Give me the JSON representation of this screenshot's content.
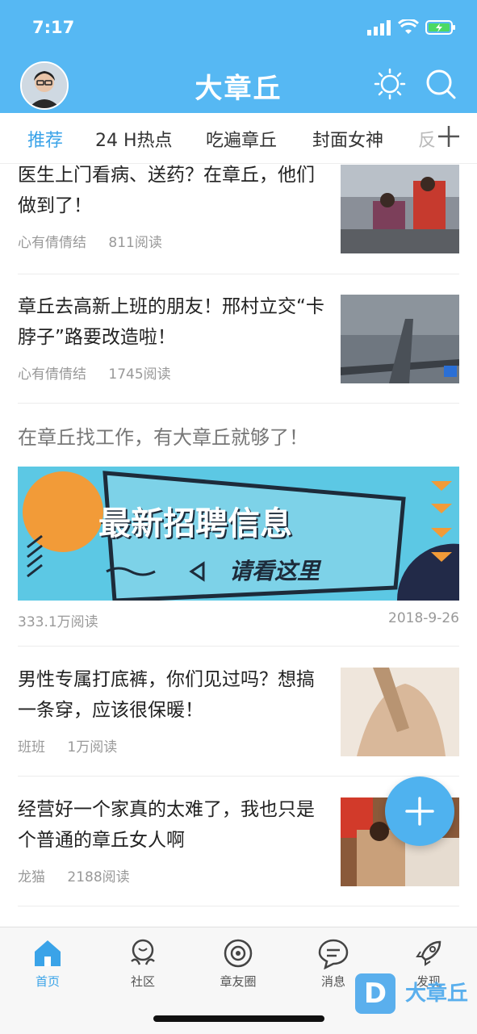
{
  "status": {
    "time": "7:17"
  },
  "header": {
    "title": "大章丘"
  },
  "tabs": [
    {
      "label": "推荐",
      "active": true
    },
    {
      "label": "24 H热点"
    },
    {
      "label": "吃遍章丘"
    },
    {
      "label": "封面女神"
    },
    {
      "label": "反"
    }
  ],
  "feed": [
    {
      "title": "医生上门看病、送药？在章丘，他们做到了！",
      "author": "心有倩倩结",
      "reads": "811阅读"
    },
    {
      "title": "章丘去高新上班的朋友！邢村立交“卡脖子”路要改造啦！",
      "author": "心有倩倩结",
      "reads": "1745阅读"
    },
    {
      "title": "在章丘找工作，有大章丘就够了！",
      "banner_text": "最新招聘信息",
      "banner_sub": "请看这里",
      "reads": "333.1万阅读",
      "date": "2018-9-26"
    },
    {
      "title": "男性专属打底裤，你们见过吗？想搞一条穿，应该很保暖！",
      "author": "班班",
      "reads": "1万阅读"
    },
    {
      "title": "经营好一个家真的太难了，我也只是个普通的章丘女人啊",
      "author": "龙猫",
      "reads": "2188阅读"
    }
  ],
  "bottom_nav": [
    {
      "label": "首页",
      "icon": "home-icon",
      "active": true
    },
    {
      "label": "社区",
      "icon": "community-icon"
    },
    {
      "label": "章友圈",
      "icon": "circle-icon"
    },
    {
      "label": "消息",
      "icon": "message-icon"
    },
    {
      "label": "发现",
      "icon": "rocket-icon"
    }
  ],
  "watermark": {
    "text": "大章丘",
    "badge": "D"
  },
  "colors": {
    "brand": "#56b8f3",
    "active_tab": "#3aa3e8",
    "fab": "#4fb2ef"
  }
}
